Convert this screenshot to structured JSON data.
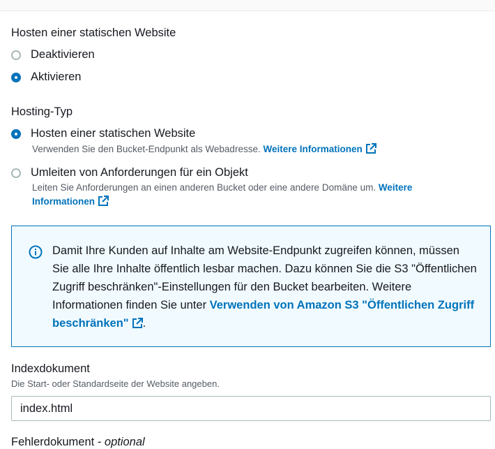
{
  "hosting": {
    "title": "Hosten einer statischen Website",
    "options": [
      {
        "label": "Deaktivieren",
        "checked": false
      },
      {
        "label": "Aktivieren",
        "checked": true
      }
    ]
  },
  "hosting_type": {
    "title": "Hosting-Typ",
    "options": [
      {
        "label": "Hosten einer statischen Website",
        "checked": true,
        "description": "Verwenden Sie den Bucket-Endpunkt als Webadresse.",
        "link": "Weitere Informationen"
      },
      {
        "label": "Umleiten von Anforderungen für ein Objekt",
        "checked": false,
        "description": "Leiten Sie Anforderungen an einen anderen Bucket oder eine andere Domäne um.",
        "link_part1": "Weitere",
        "link_part2": "Informationen"
      }
    ]
  },
  "info_alert": {
    "icon": "info-icon",
    "text": "Damit Ihre Kunden auf Inhalte am Website-Endpunkt zugreifen können, müssen Sie alle Ihre Inhalte öffentlich lesbar machen. Dazu können Sie die S3 \"Öffentlichen Zugriff beschränken\"-Einstellungen für den Bucket bearbeiten. Weitere Informationen finden Sie unter ",
    "link": "Verwenden von Amazon S3 \"Öffentlichen Zugriff beschränken\"",
    "suffix": "."
  },
  "index_document": {
    "label": "Indexdokument",
    "description": "Die Start- oder Standardseite der Website angeben.",
    "value": "index.html"
  },
  "error_document": {
    "label": "Fehlerdokument",
    "separator": " - ",
    "optional": "optional"
  },
  "colors": {
    "accent": "#0073bb",
    "text": "#16191f",
    "muted": "#545b64",
    "info_bg": "#f1faff"
  }
}
